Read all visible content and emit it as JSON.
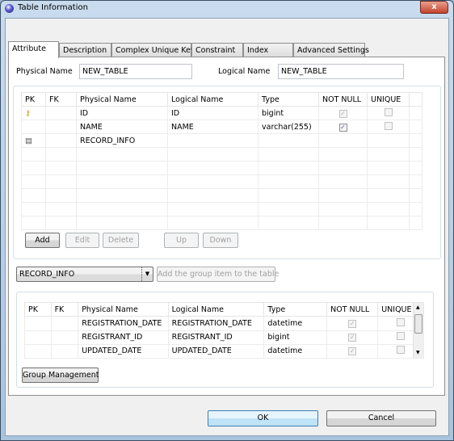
{
  "window": {
    "title": "Table Information",
    "close_label": "x"
  },
  "tabs": [
    {
      "label": "Attribute",
      "selected": true
    },
    {
      "label": "Description"
    },
    {
      "label": "Complex Unique Key"
    },
    {
      "label": "Constraint"
    },
    {
      "label": "Index"
    },
    {
      "label": "Advanced Settings"
    }
  ],
  "form": {
    "physical_name_label": "Physical Name",
    "physical_name_value": "NEW_TABLE",
    "logical_name_label": "Logical Name",
    "logical_name_value": "NEW_TABLE"
  },
  "columns_table": {
    "headers": [
      "PK",
      "FK",
      "Physical Name",
      "Logical Name",
      "Type",
      "NOT NULL",
      "UNIQUE"
    ],
    "rows": [
      {
        "pk_icon": "key-icon",
        "fk": "",
        "physical": "ID",
        "logical": "ID",
        "type": "bigint",
        "not_null": true,
        "not_null_disabled": true,
        "unique": false
      },
      {
        "pk_icon": "",
        "fk": "",
        "physical": "NAME",
        "logical": "NAME",
        "type": "varchar(255)",
        "not_null": true,
        "not_null_disabled": false,
        "unique": false
      },
      {
        "pk_icon": "group-icon",
        "fk": "",
        "physical": "RECORD_INFO",
        "logical": "",
        "type": "",
        "not_null": null,
        "unique": null
      }
    ]
  },
  "buttons": {
    "add": "Add",
    "edit": "Edit",
    "delete": "Delete",
    "up": "Up",
    "down": "Down",
    "add_group_item": "Add the group item to the table",
    "group_management": "Group Management",
    "ok": "OK",
    "cancel": "Cancel"
  },
  "group_select": {
    "value": "RECORD_INFO"
  },
  "group_table": {
    "headers": [
      "PK",
      "FK",
      "Physical Name",
      "Logical Name",
      "Type",
      "NOT NULL",
      "UNIQUE"
    ],
    "rows": [
      {
        "physical": "REGISTRATION_DATE",
        "logical": "REGISTRATION_DATE",
        "type": "datetime",
        "not_null": true,
        "unique": false
      },
      {
        "physical": "REGISTRANT_ID",
        "logical": "REGISTRANT_ID",
        "type": "bigint",
        "not_null": true,
        "unique": false
      },
      {
        "physical": "UPDATED_DATE",
        "logical": "UPDATED_DATE",
        "type": "datetime",
        "not_null": true,
        "unique": false
      }
    ]
  }
}
